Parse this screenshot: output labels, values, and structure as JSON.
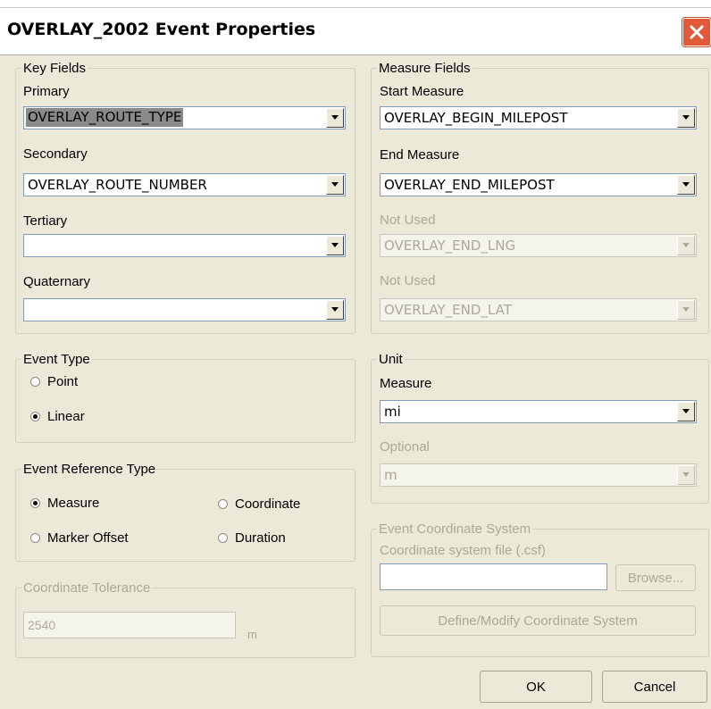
{
  "window": {
    "title": "OVERLAY_2002 Event Properties",
    "close_icon": "close-icon"
  },
  "key_fields": {
    "legend": "Key Fields",
    "primary_label": "Primary",
    "primary_value": "OVERLAY_ROUTE_TYPE",
    "secondary_label": "Secondary",
    "secondary_value": "OVERLAY_ROUTE_NUMBER",
    "tertiary_label": "Tertiary",
    "tertiary_value": "",
    "quaternary_label": "Quaternary",
    "quaternary_value": ""
  },
  "measure_fields": {
    "legend": "Measure Fields",
    "start_label": "Start Measure",
    "start_value": "OVERLAY_BEGIN_MILEPOST",
    "end_label": "End Measure",
    "end_value": "OVERLAY_END_MILEPOST",
    "notused1_label": "Not Used",
    "notused1_value": "OVERLAY_END_LNG",
    "notused2_label": "Not Used",
    "notused2_value": "OVERLAY_END_LAT"
  },
  "event_type": {
    "legend": "Event Type",
    "point_label": "Point",
    "linear_label": "Linear",
    "selected": "Linear"
  },
  "unit": {
    "legend": "Unit",
    "measure_label": "Measure",
    "measure_value": "mi",
    "optional_label": "Optional",
    "optional_value": "m"
  },
  "event_reference_type": {
    "legend": "Event Reference Type",
    "measure_label": "Measure",
    "coordinate_label": "Coordinate",
    "marker_offset_label": "Marker Offset",
    "duration_label": "Duration",
    "selected": "Measure"
  },
  "event_coordinate_system": {
    "legend": "Event Coordinate System",
    "file_label": "Coordinate system file (.csf)",
    "file_value": "",
    "browse_label": "Browse...",
    "define_label": "Define/Modify Coordinate System"
  },
  "coordinate_tolerance": {
    "legend": "Coordinate Tolerance",
    "value": "2540",
    "unit": "m"
  },
  "buttons": {
    "ok_label": "OK",
    "cancel_label": "Cancel"
  }
}
